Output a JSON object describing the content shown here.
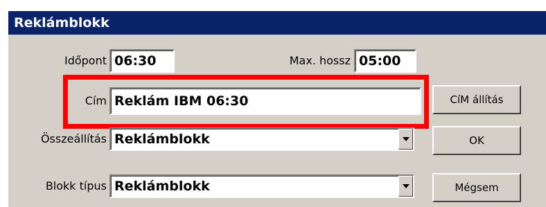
{
  "window": {
    "title": "Reklámblokk"
  },
  "fields": {
    "idopont": {
      "label": "Időpont",
      "value": "06:30"
    },
    "max_hossz": {
      "label": "Max. hossz",
      "value": "05:00"
    },
    "cim": {
      "label": "Cím",
      "value": "Reklám IBM 06:30"
    },
    "osszeallitas": {
      "label": "Összeállítás",
      "value": "Reklámblokk"
    },
    "blokk_tipus": {
      "label": "Blokk típus",
      "value": "Reklámblokk"
    }
  },
  "buttons": {
    "cim_allitas": "CíM állítás",
    "ok": "OK",
    "megsem": "Mégsem"
  },
  "icons": {
    "dropdown": "dropdown-arrow-icon"
  },
  "colors": {
    "titlebar": "#0a246a",
    "highlight": "#ff0000"
  }
}
